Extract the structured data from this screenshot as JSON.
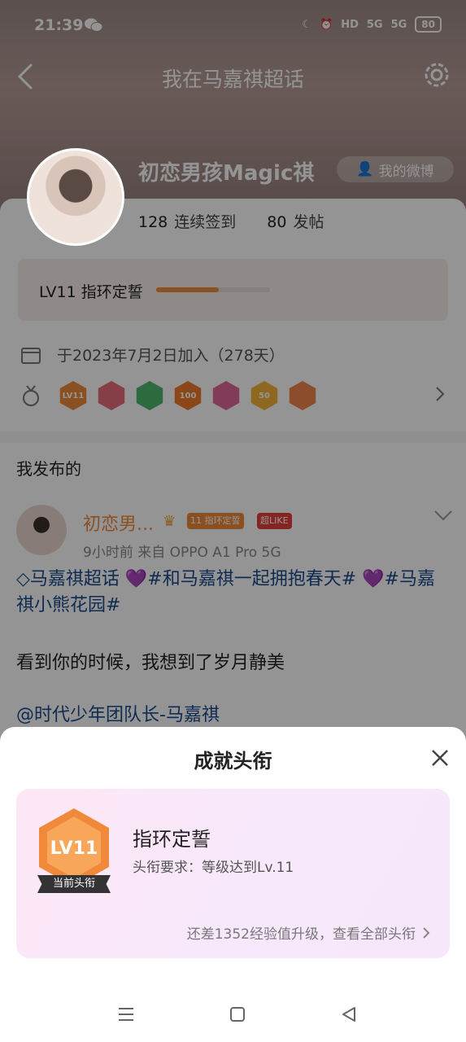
{
  "status_bar": {
    "time": "21:39",
    "net_hd": "HD",
    "net_5g_1": "5G",
    "net_5g_2": "5G",
    "battery": "80"
  },
  "nav": {
    "title": "我在马嘉祺超话"
  },
  "profile": {
    "username": "初恋男孩Magic祺",
    "weibo_button": "我的微博",
    "checkin_count": "128",
    "checkin_label": "连续签到",
    "post_count": "80",
    "post_label": "发帖",
    "level_text": "LV11 指环定誓",
    "level_progress": 0.55,
    "join_text": "于2023年7月2日加入（278天）",
    "badges": [
      {
        "text": "LV11",
        "color": "#f08a3a"
      },
      {
        "text": "",
        "color": "#e76b7b"
      },
      {
        "text": "",
        "color": "#4ab86a"
      },
      {
        "text": "100",
        "color": "#f07a2a"
      },
      {
        "text": "",
        "color": "#e0679a"
      },
      {
        "text": "50",
        "color": "#f4b43a"
      },
      {
        "text": "",
        "color": "#f0864a"
      }
    ]
  },
  "section": {
    "title": "我发布的"
  },
  "post": {
    "author": "初恋男...",
    "tag_level": "11 指环定誓",
    "tag_like": "超LIKE",
    "time_source": "9小时前   来自 OPPO A1 Pro 5G",
    "topic_line": "马嘉祺超话 💜#和马嘉祺一起拥抱春天# 💜#马嘉祺小熊花园#",
    "body": "看到你的时候，我想到了岁月静美",
    "mention": "@时代少年团队长-马嘉祺"
  },
  "sheet": {
    "title": "成就头衔",
    "badge_text": "LV11",
    "current_label": "当前头衔",
    "name": "指环定誓",
    "requirement": "头衔要求：等级达到Lv.11",
    "link": "还差1352经验值升级，查看全部头衔"
  },
  "colors": {
    "accent": "#f08a3a",
    "link_blue": "#1c4b8c"
  }
}
